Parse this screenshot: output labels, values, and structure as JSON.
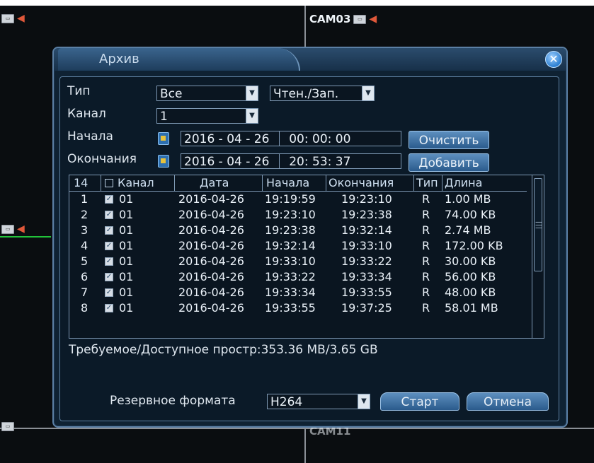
{
  "background": {
    "cam_top_right": "CAM03",
    "cam_bottom_center": "CAM11"
  },
  "dialog": {
    "title": "Архив",
    "close_glyph": "✕",
    "type_label": "Тип",
    "type_value": "Все",
    "mode_value": "Чтен./Зап.",
    "channel_label": "Канал",
    "channel_value": "1",
    "start_label": "Начала",
    "start_date": "2016 - 04 - 26",
    "start_time": "00: 00: 00",
    "end_label": "Окончания",
    "end_date": "2016 - 04 - 26",
    "end_time": "20: 53: 37",
    "clear_button": "Очистить",
    "add_button": "Добавить",
    "storage_text": "Требуемое/Доступное простр:353.36 MB/3.65 GB",
    "format_label": "Резервное формата",
    "format_value": "H264",
    "start_button": "Старт",
    "cancel_button": "Отмена"
  },
  "table": {
    "count": "14",
    "headers": {
      "channel": "Канал",
      "date": "Дата",
      "start": "Начала",
      "end": "Окончания",
      "type": "Тип",
      "length": "Длина"
    },
    "rows": [
      {
        "n": "1",
        "ch": "01",
        "date": "2016-04-26",
        "start": "19:19:59",
        "end": "19:23:10",
        "type": "R",
        "len": "1.00 MB"
      },
      {
        "n": "2",
        "ch": "01",
        "date": "2016-04-26",
        "start": "19:23:10",
        "end": "19:23:38",
        "type": "R",
        "len": "74.00 KB"
      },
      {
        "n": "3",
        "ch": "01",
        "date": "2016-04-26",
        "start": "19:23:38",
        "end": "19:32:14",
        "type": "R",
        "len": "2.74 MB"
      },
      {
        "n": "4",
        "ch": "01",
        "date": "2016-04-26",
        "start": "19:32:14",
        "end": "19:33:10",
        "type": "R",
        "len": "172.00 KB"
      },
      {
        "n": "5",
        "ch": "01",
        "date": "2016-04-26",
        "start": "19:33:10",
        "end": "19:33:22",
        "type": "R",
        "len": "30.00 KB"
      },
      {
        "n": "6",
        "ch": "01",
        "date": "2016-04-26",
        "start": "19:33:22",
        "end": "19:33:34",
        "type": "R",
        "len": "56.00 KB"
      },
      {
        "n": "7",
        "ch": "01",
        "date": "2016-04-26",
        "start": "19:33:34",
        "end": "19:33:55",
        "type": "R",
        "len": "48.00 KB"
      },
      {
        "n": "8",
        "ch": "01",
        "date": "2016-04-26",
        "start": "19:33:55",
        "end": "19:37:25",
        "type": "R",
        "len": "58.01 MB"
      }
    ]
  },
  "colors": {
    "dialog_bg": "#0f2233",
    "border": "#5b7fa4",
    "button": "#3f73a6",
    "accent_green": "#22c23a"
  }
}
